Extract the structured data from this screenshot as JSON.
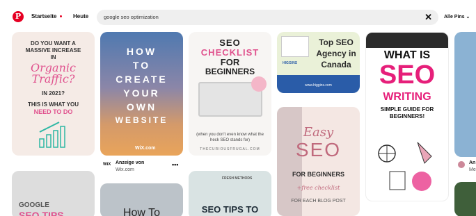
{
  "header": {
    "home_label": "Startseite",
    "today_label": "Heute",
    "search_value": "google seo optimization",
    "filter_label": "Alle Pins"
  },
  "pins": {
    "p1": {
      "line1": "DO YOU WANT A",
      "line2": "MASSIVE INCREASE",
      "line3": "IN",
      "script": "Organic Traffic?",
      "line4": "IN 2021?",
      "line5": "THIS IS WHAT YOU",
      "line6": "NEED TO DO"
    },
    "p2": {
      "lines": [
        "HOW",
        "TO",
        "CREATE",
        "YOUR",
        "OWN",
        "WEBSITE"
      ],
      "brand": "WiX.com"
    },
    "p3": {
      "line1": "SEO",
      "line2": "CHECKLIST",
      "line3": "FOR",
      "line4": "BEGINNERS",
      "caption": "(when you don't even know what the heck SEO stands for)",
      "source": "THECURIOUSFRUGAL.COM"
    },
    "p4": {
      "badge": "HIGGINS",
      "line1": "Top SEO",
      "line2": "Agency in",
      "line3": "Canada",
      "site": "www.higgins.com"
    },
    "p5": {
      "script": "Easy",
      "big": "SEO",
      "line1": "FOR BEGINNERS",
      "line2": "+free checklist",
      "line3": "FOR EACH BLOG POST"
    },
    "p6": {
      "line1": "WHAT IS",
      "big": "SEO",
      "line2": "WRITING",
      "line3": "SIMPLE GUIDE FOR BEGINNERS!"
    },
    "p8": {
      "line1": "GOOGLE",
      "line2": "SEO TIPS"
    },
    "p9": {
      "line1": "How To"
    },
    "p10": {
      "badge": "FRESH METHODS",
      "line1": "SEO TIPS TO"
    }
  },
  "ad": {
    "label": "Anzeige von",
    "source": "Wix.com",
    "more": "•••"
  },
  "side": {
    "name": "An",
    "sub": "Me"
  }
}
